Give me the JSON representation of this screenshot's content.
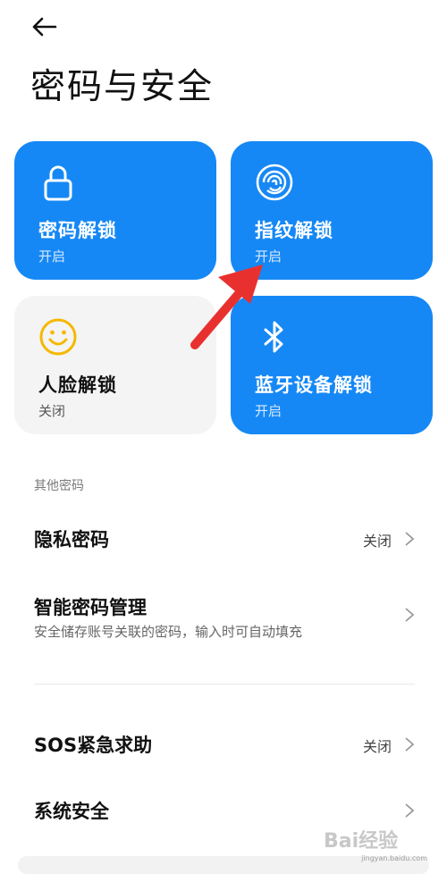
{
  "header": {
    "back_icon": "arrow-left-icon",
    "title": "密码与安全"
  },
  "cards": [
    {
      "id": "password",
      "icon": "lock-icon",
      "title": "密码解锁",
      "status": "开启",
      "enabled": true
    },
    {
      "id": "fingerprint",
      "icon": "fingerprint-icon",
      "title": "指纹解锁",
      "status": "开启",
      "enabled": true
    },
    {
      "id": "face",
      "icon": "smiley-face-icon",
      "title": "人脸解锁",
      "status": "关闭",
      "enabled": false
    },
    {
      "id": "bluetooth",
      "icon": "bluetooth-icon",
      "title": "蓝牙设备解锁",
      "status": "开启",
      "enabled": true
    }
  ],
  "section": {
    "label": "其他密码"
  },
  "rows": [
    {
      "title": "隐私密码",
      "value": "关闭"
    },
    {
      "title": "智能密码管理",
      "subtitle": "安全储存账号关联的密码，输入时可自动填充"
    },
    {
      "title": "SOS紧急求助",
      "value": "关闭"
    },
    {
      "title": "系统安全"
    }
  ],
  "watermark": {
    "text": "Bai经验",
    "url": "jingyan.baidu.com"
  },
  "colors": {
    "accent": "#1688f5",
    "card_off": "#f4f4f4",
    "face_icon": "#f5b800",
    "annotation_arrow": "#e8312f"
  }
}
